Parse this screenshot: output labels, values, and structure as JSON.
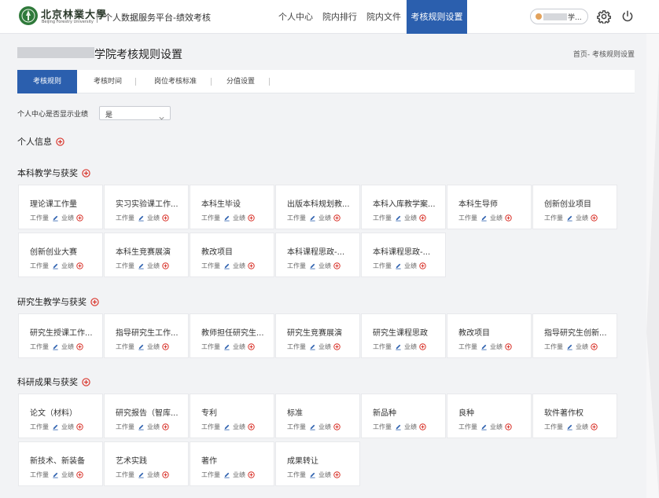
{
  "header": {
    "logo_cn": "北京林業大學",
    "logo_en": "Beijing Forestry University",
    "platform_title": "个人数据服务平台-绩效考核",
    "nav": [
      {
        "label": "个人中心",
        "active": false
      },
      {
        "label": "院内排行",
        "active": false
      },
      {
        "label": "院内文件",
        "active": false
      },
      {
        "label": "考核规则设置",
        "active": true
      }
    ],
    "user_name_suffix": "学..."
  },
  "page": {
    "title": "学院考核规则设置",
    "breadcrumb": "首页- 考核规则设置"
  },
  "tabs": [
    {
      "label": "考核规则",
      "active": true
    },
    {
      "label": "考核时间",
      "active": false
    },
    {
      "label": "岗位考核标准",
      "active": false
    },
    {
      "label": "分值设置",
      "active": false
    }
  ],
  "setting": {
    "label": "个人中心是否显示业绩",
    "value": "是"
  },
  "card_meta": {
    "workload": "工作量",
    "performance": "业绩"
  },
  "sections": [
    {
      "title": "个人信息",
      "cards": []
    },
    {
      "title": "本科教学与获奖",
      "cards": [
        "理论课工作量",
        "实习实验课工作...",
        "本科生毕设",
        "出版本科规划教...",
        "本科入库教学案...",
        "本科生导师",
        "创新创业项目",
        "创新创业大赛",
        "本科生竞赛展演",
        "教改项目",
        "本科课程思政-...",
        "本科课程思政-..."
      ]
    },
    {
      "title": "研究生教学与获奖",
      "cards": [
        "研究生授课工作...",
        "指导研究生工作...",
        "教师担任研究生...",
        "研究生竞赛展演",
        "研究生课程思政",
        "教改项目",
        "指导研究生创新..."
      ]
    },
    {
      "title": "科研成果与获奖",
      "cards": [
        "论文（材料）",
        "研究报告（智库...",
        "专利",
        "标准",
        "新品种",
        "良种",
        "软件著作权",
        "新技术、新装备",
        "艺术实践",
        "著作",
        "成果转让"
      ]
    }
  ],
  "colors": {
    "primary": "#2b5fae",
    "accent_red": "#d9342b",
    "logo_green": "#2f7a3b"
  }
}
